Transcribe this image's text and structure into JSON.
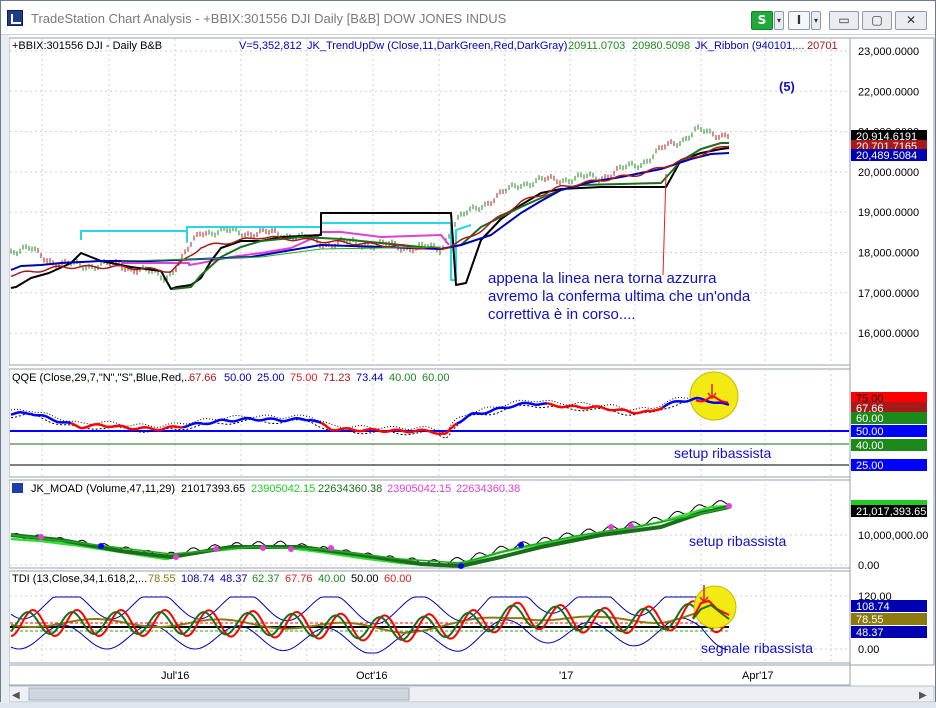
{
  "window": {
    "title": "TradeStation Chart Analysis - +BBIX:301556 DJI Daily [B&B] DOW JONES INDUS",
    "s_button": "S",
    "i_button": "I",
    "dropdown_glyph": "▾",
    "minimize_glyph": "▭",
    "maximize_glyph": "▢",
    "close_glyph": "✕"
  },
  "colors": {
    "up_bar": "#1b8a1b",
    "down_bar": "#b01818",
    "black": "#000000",
    "dark_green": "#1b6e1b",
    "navy": "#0000b0",
    "cyan": "#26d6ea",
    "magenta": "#e040d8",
    "dark_red": "#a81a1a",
    "green": "#22aa22",
    "lime": "#33dd33",
    "olive": "#8a7a10",
    "blue": "#0000ff",
    "red": "#ff0000",
    "yellow": "#f2ea12",
    "annotation": "#1010c8"
  },
  "price_panel": {
    "header": {
      "symbol": "+BBIX:301556 DJI - Daily  B&B",
      "volume": "V=5,352,812",
      "indicator": "JK_TrendUpDw (Close,11,DarkGreen,Red,DarkGray)",
      "value_1": "20911.0703",
      "value_2": "20980.5098",
      "ribbon": "JK_Ribbon (940101,...",
      "value_3": "20701"
    },
    "y_ticks": [
      "23,000.0000",
      "22,000.0000",
      "21,000.0000",
      "20,000.0000",
      "19,000.0000",
      "18,000.0000",
      "17,000.0000",
      "16,000.0000"
    ],
    "value_boxes": [
      {
        "text": "20,914.6191",
        "bg": "#000000",
        "fg": "#ffffff"
      },
      {
        "text": "20,701.7165",
        "bg": "#a81a1a",
        "fg": "#ffffff"
      },
      {
        "text": "20,489.5084",
        "bg": "#0000b0",
        "fg": "#ffffff"
      }
    ],
    "wave_label": "(5)",
    "annotation": [
      "appena la linea nera torna azzurra",
      "avremo la conferma ultima che un'onda",
      "correttiva è in corso...."
    ]
  },
  "qqe_panel": {
    "header": {
      "name": "QQE (Close,29,7,\"N\",\"S\",Blue,Red,...",
      "v1": "67.66",
      "v2": "50.00",
      "v3": "25.00",
      "v4": "75.00",
      "v5": "71.23",
      "v6": "73.44",
      "v7": "40.00",
      "v8": "60.00"
    },
    "value_boxes": [
      {
        "text": "75.00",
        "bg": "#ff0000",
        "fg": "#000000"
      },
      {
        "text": "67.66",
        "bg": "#a81a1a",
        "fg": "#ffffff"
      },
      {
        "text": "60.00",
        "bg": "#1b8a1b",
        "fg": "#ffffff"
      },
      {
        "text": "50.00",
        "bg": "#0000ff",
        "fg": "#ffffff"
      },
      {
        "text": "40.00",
        "bg": "#1b8a1b",
        "fg": "#ffffff"
      },
      {
        "text": "25.00",
        "bg": "#0000ff",
        "fg": "#ffffff"
      }
    ],
    "annotation": "setup ribassista"
  },
  "moad_panel": {
    "header": {
      "name": "JK_MOAD (Volume,47,11,29)",
      "v1": "21017393.65",
      "v2": "23905042.15",
      "v3": "22634360.38",
      "v4": "23905042.15",
      "v5": "22634360.38"
    },
    "y_ticks": [
      "10,000,000.00",
      "0.00"
    ],
    "value_boxes": [
      {
        "text": "21,017,393.65",
        "bg": "#000000",
        "fg": "#ffffff"
      }
    ],
    "annotation": "setup ribassista"
  },
  "tdi_panel": {
    "header": {
      "name": "TDI (13,Close,34,1.618,2,...",
      "v1": "78.55",
      "v2": "108.74",
      "v3": "48.37",
      "v4": "62.37",
      "v5": "67.76",
      "v6": "40.00",
      "v7": "50.00",
      "v8": "60.00"
    },
    "y_ticks": [
      "120.00",
      "0.00"
    ],
    "value_boxes": [
      {
        "text": "108.74",
        "bg": "#0000b0",
        "fg": "#ffffff"
      },
      {
        "text": "78.55",
        "bg": "#8a7a10",
        "fg": "#ffffff"
      },
      {
        "text": "48.37",
        "bg": "#0000b0",
        "fg": "#ffffff"
      }
    ],
    "annotation": "segnale ribassista"
  },
  "x_axis": {
    "labels": [
      "Jul'16",
      "Oct'16",
      "'17",
      "Apr'17"
    ]
  },
  "scrollbar": {
    "left_arrow": "◀",
    "right_arrow": "▶"
  }
}
